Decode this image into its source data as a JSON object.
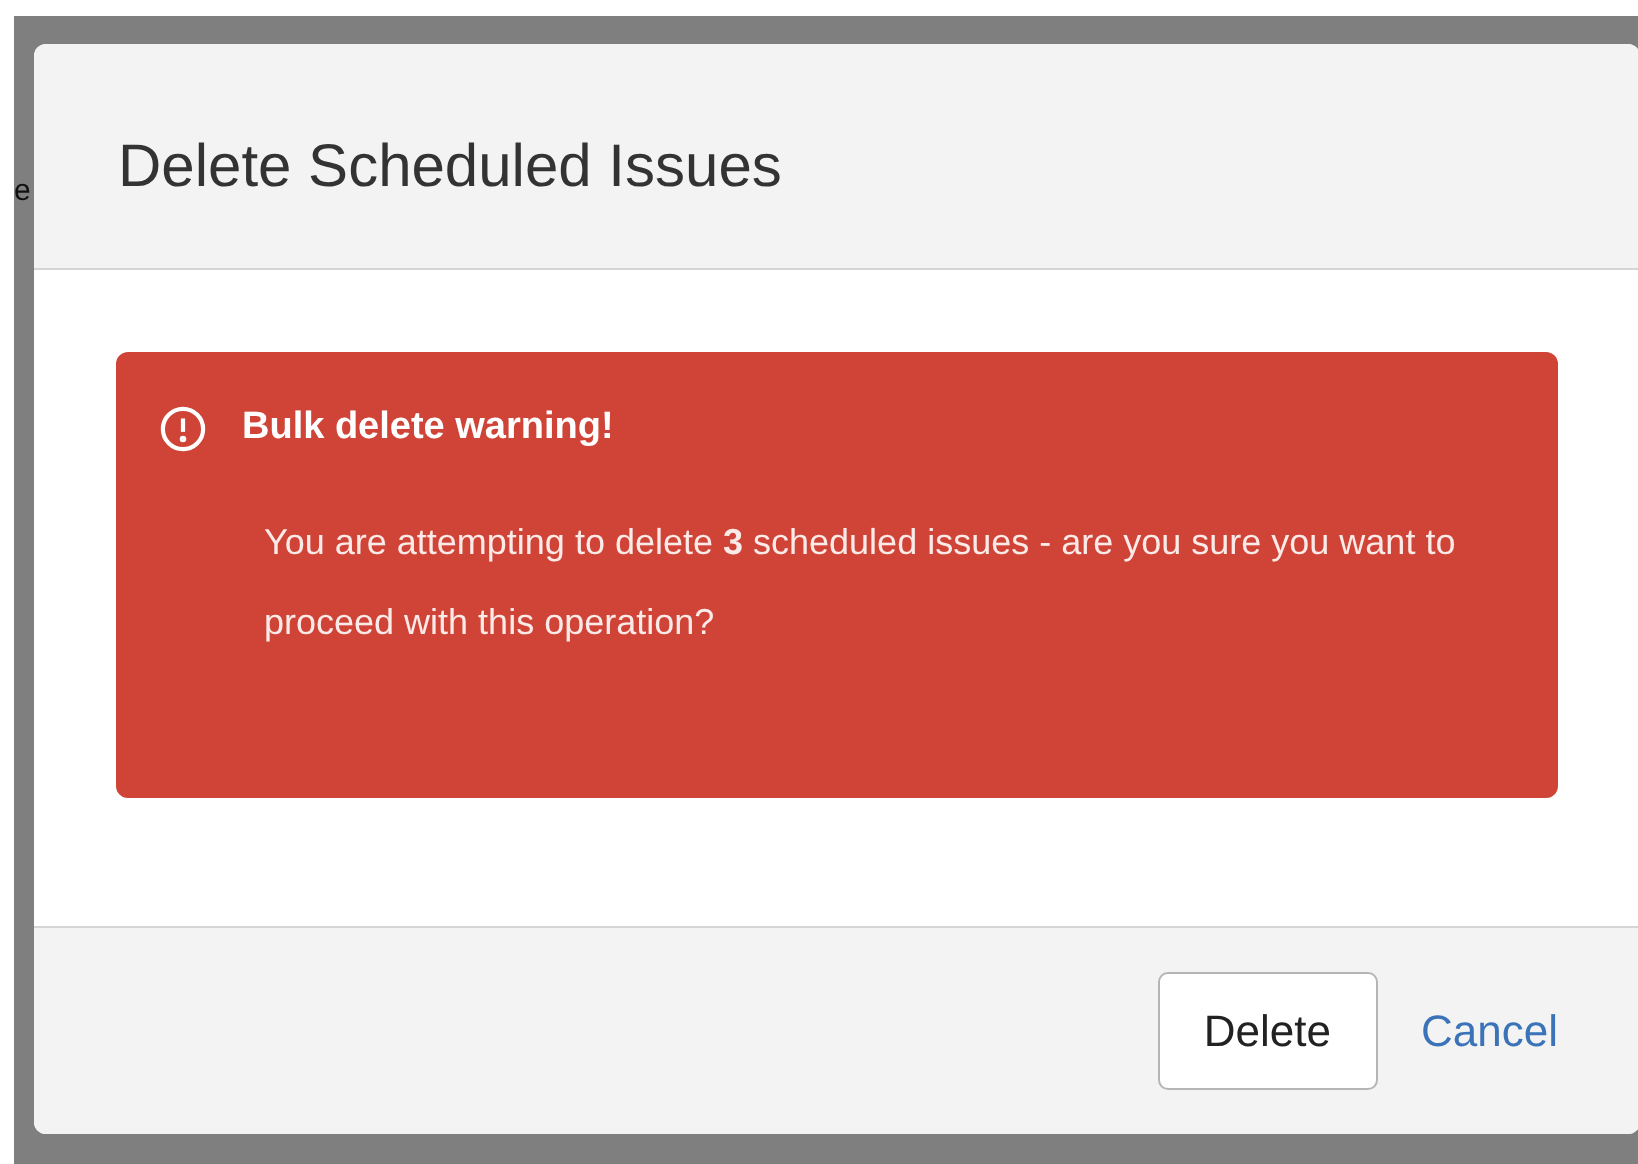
{
  "background_text": "e",
  "dialog": {
    "title": "Delete Scheduled Issues",
    "alert": {
      "title": "Bulk delete warning!",
      "message": "You are attempting to delete **3** scheduled issues - are you sure you want to proceed with this operation?"
    },
    "buttons": [
      {
        "kind": "button",
        "label": "Delete"
      },
      {
        "kind": "link",
        "label": "Cancel"
      }
    ]
  }
}
